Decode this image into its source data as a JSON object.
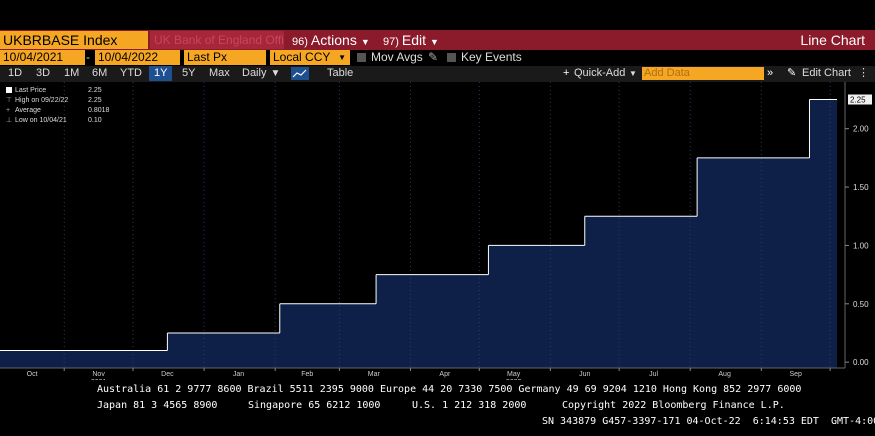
{
  "header": {
    "ticker": "UKBRBASE Index",
    "ticker_desc": "UK Bank of England Official Ba",
    "actions_num": "96)",
    "actions": "Actions",
    "edit_num": "97)",
    "edit": "Edit",
    "chart_type": "Line Chart"
  },
  "controls": {
    "start_date": "10/04/2021",
    "dash": "-",
    "end_date": "10/04/2022",
    "field": "Last Px",
    "currency": "Local CCY",
    "mov_avgs": "Mov Avgs",
    "key_events": "Key Events"
  },
  "toolbar": {
    "ranges": [
      "1D",
      "3D",
      "1M",
      "6M",
      "YTD",
      "1Y",
      "5Y",
      "Max"
    ],
    "selected": "1Y",
    "frequency": "Daily",
    "table": "Table",
    "quick_add": "Quick-Add",
    "add_data_placeholder": "Add Data",
    "edit_chart": "Edit Chart"
  },
  "legend": {
    "last_label": "Last Price",
    "last_value": "2.25",
    "high_label": "High on 09/22/22",
    "high_value": "2.25",
    "avg_label": "Average",
    "avg_value": "0.8018",
    "low_label": "Low on 10/04/21",
    "low_value": "0.10"
  },
  "colors": {
    "accent": "#f5a623",
    "header_bar": "#8b1a2b",
    "area_fill": "#0e1f48",
    "line": "#ffffff"
  },
  "chart_data": {
    "type": "area",
    "title": "",
    "xlabel": "",
    "ylabel": "",
    "ylim": [
      -0.05,
      2.4
    ],
    "yticks": [
      "0.00",
      "0.50",
      "1.00",
      "1.50",
      "2.00"
    ],
    "ytick_values": [
      0,
      0.5,
      1.0,
      1.5,
      2.0
    ],
    "last_marker": "2.25",
    "months": [
      "Oct",
      "Nov",
      "Dec",
      "Jan",
      "Feb",
      "Mar",
      "Apr",
      "May",
      "Jun",
      "Jul",
      "Aug",
      "Sep"
    ],
    "year_labels": [
      {
        "text": "2021",
        "month": "Nov"
      },
      {
        "text": "2022",
        "month": "May"
      }
    ],
    "xlim": [
      "2021-10-04",
      "2022-10-04"
    ],
    "steps": [
      {
        "date": "2021-10-04",
        "value": 0.1
      },
      {
        "date": "2021-12-16",
        "value": 0.25
      },
      {
        "date": "2022-02-03",
        "value": 0.5
      },
      {
        "date": "2022-03-17",
        "value": 0.75
      },
      {
        "date": "2022-05-05",
        "value": 1.0
      },
      {
        "date": "2022-06-16",
        "value": 1.25
      },
      {
        "date": "2022-08-04",
        "value": 1.75
      },
      {
        "date": "2022-09-22",
        "value": 2.25
      },
      {
        "date": "2022-10-04",
        "value": 2.25
      }
    ]
  },
  "footer": {
    "line1": "Australia 61 2 9777 8600 Brazil 5511 2395 9000 Europe 44 20 7330 7500 Germany 49 69 9204 1210 Hong Kong 852 2977 6000",
    "line2a": "Japan 81 3 4565 8900",
    "line2b": "Singapore 65 6212 1000",
    "line2c": "U.S. 1 212 318 2000",
    "line2d": "Copyright 2022 Bloomberg Finance L.P.",
    "line3": "SN 343879 G457-3397-171 04-Oct-22  6:14:53 EDT  GMT-4:00"
  }
}
